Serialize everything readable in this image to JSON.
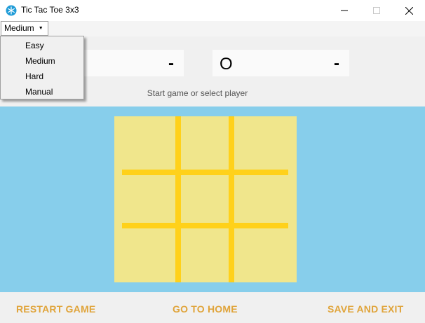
{
  "window": {
    "title": "Tic Tac Toe 3x3",
    "icon": "snowflake-icon",
    "controls": {
      "minimize": "—",
      "maximize": "☐",
      "close": "✕"
    }
  },
  "difficulty": {
    "selected": "Medium",
    "options": [
      "Easy",
      "Medium",
      "Hard",
      "Manual"
    ]
  },
  "scores": {
    "left": {
      "symbol": "",
      "value": "-"
    },
    "right": {
      "symbol": "O",
      "value": "-"
    }
  },
  "status": "Start game or select player",
  "board": {
    "cells": [
      "",
      "",
      "",
      "",
      "",
      "",
      "",
      "",
      ""
    ]
  },
  "actions": {
    "restart": "RESTART GAME",
    "home": "GO TO HOME",
    "save_exit": "SAVE AND EXIT"
  },
  "colors": {
    "board_area": "#87ceeb",
    "board": "#f0e68c",
    "grid_lines": "#ffd11a",
    "action_text": "#e0a43a"
  }
}
